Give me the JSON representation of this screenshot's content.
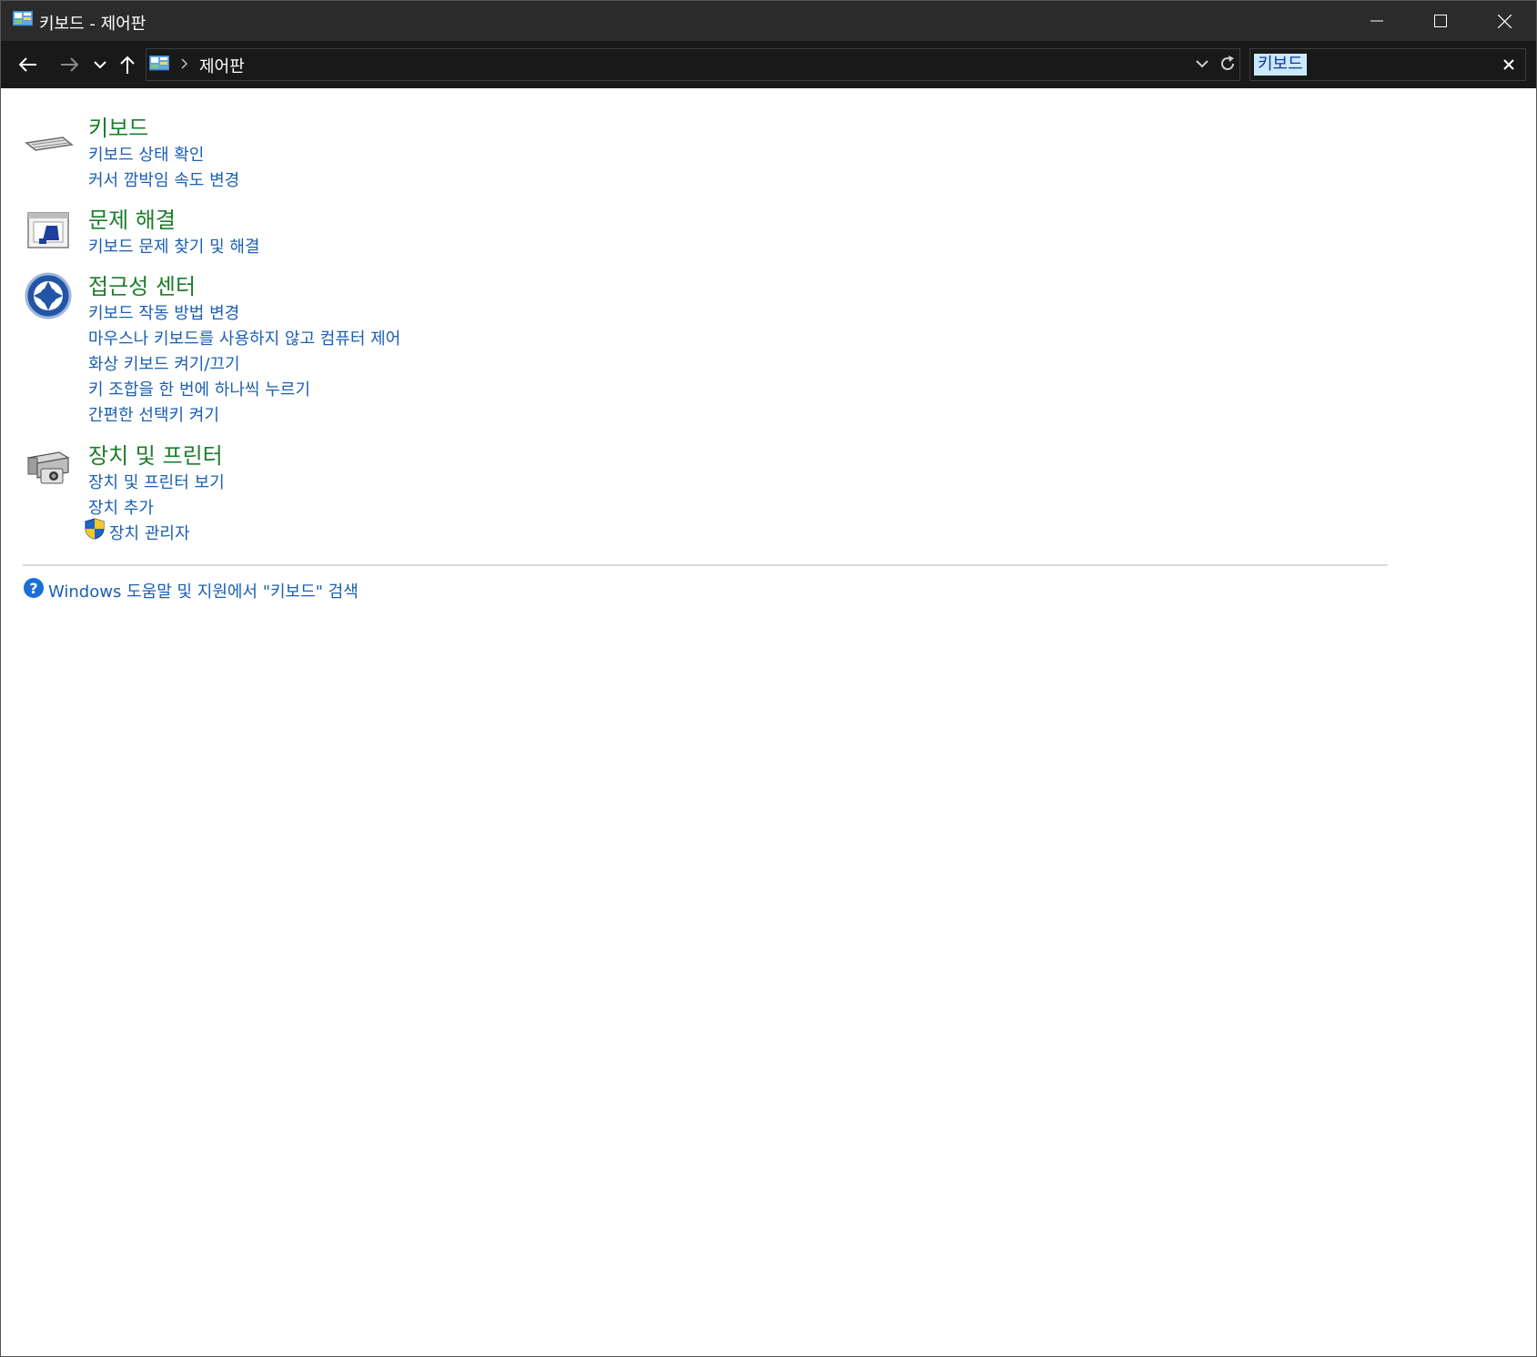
{
  "window": {
    "title": "키보드 - 제어판",
    "app_icon": "control-panel-icon",
    "controls": [
      "minimize-icon",
      "maximize-icon",
      "close-icon"
    ]
  },
  "navigation": {
    "back_icon": "arrow-left-icon",
    "forward_icon": "arrow-right-icon",
    "recent_icon": "chevron-down-icon",
    "up_icon": "arrow-up-icon",
    "address": {
      "icon": "control-panel-icon",
      "separator_icon": "chevron-right-icon",
      "crumb": "제어판",
      "dropdown_icon": "chevron-down-icon",
      "refresh_icon": "refresh-icon"
    },
    "search": {
      "value": "키보드",
      "clear_icon": "close-icon"
    }
  },
  "results": [
    {
      "title": "키보드",
      "icon": "keyboard-icon",
      "links": [
        "키보드 상태 확인",
        "커서 깜박임 속도 변경"
      ]
    },
    {
      "title": "문제 해결",
      "icon": "troubleshooting-icon",
      "links": [
        "키보드 문제 찾기 및 해결"
      ]
    },
    {
      "title": "접근성 센터",
      "icon": "ease-of-access-icon",
      "links": [
        "키보드 작동 방법 변경",
        "마우스나 키보드를 사용하지 않고 컴퓨터 제어",
        "화상 키보드 켜기/끄기",
        "키 조합을 한 번에 하나씩 누르기",
        "간편한 선택키 켜기"
      ]
    },
    {
      "title": "장치 및 프린터",
      "icon": "devices-printers-icon",
      "links": [
        "장치 및 프린터 보기",
        "장치 추가",
        "장치 관리자"
      ],
      "admin_shield_icon": "uac-shield-icon"
    }
  ],
  "help": {
    "icon": "help-question-icon",
    "text": "Windows 도움말 및 지원에서 \"키보드\" 검색"
  },
  "colors": {
    "titlebar": "#2b2b2b",
    "navbar": "#191919",
    "category_title": "#1c7d2c",
    "link": "#1a5fb4",
    "search_selection": "#cce8ff"
  }
}
